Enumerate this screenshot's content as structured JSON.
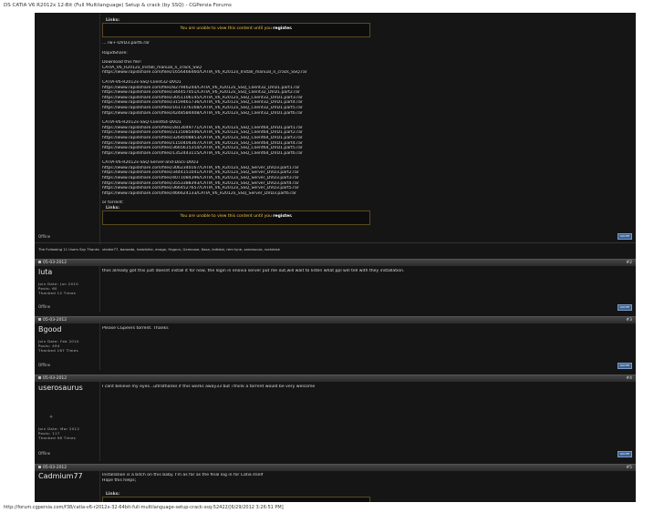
{
  "doc_title": "DS CATIA V6 R2012x 12-Bit (Full Multilanguage) Setup & crack (by SSQ) - CGPersia Forums",
  "footer_url": "http://forum.cgpersia.com/f38/catia-v6-r2012x-32-64bit-full-multilanguage-setup-crack-ssq-52422/[6/29/2012 3:26:51 PM]",
  "links_label": "Links:",
  "links_message_pre": "You are unable to view this content until you",
  "links_message_link": "register.",
  "post1": {
    "text_top": "... rw+-DVD3.part6.rar",
    "rapidshare": "RapidShare:",
    "download_intro": "Download this file!",
    "intro_lines": [
      "CATIA_V6_R2012x_Install_manual_n_crack_SSQ",
      "https://www.rapidshare.com/files/1656466460/CATIA_V6_R2012x_Install_manual_n_crack_SSQ.rar"
    ],
    "group1_title": "CATIA-V6-R2012x-SSQ-Client32-DVD1",
    "group1": [
      "https://www.rapidshare.com/files/827946244/CATIA_V6_R2012x_SSQ_Client32_DVD1.part1.rar",
      "https://www.rapidshare.com/files/344457051/CATIA_V6_R2012x_SSQ_Client32_DVD1.part2.rar",
      "https://www.rapidshare.com/files/3051106145/CATIA_V6_R2012x_SSQ_Client32_DVD1.part3.rar",
      "https://www.rapidshare.com/files/3159461736/CATIA_V6_R2012x_SSQ_Client32_DVD1.part4.rar",
      "https://www.rapidshare.com/files/1617376168/CATIA_V6_R2012x_SSQ_Client32_DVD1.part5.rar",
      "https://www.rapidshare.com/files/4248584408/CATIA_V6_R2012x_SSQ_Client32_DVD1.part6.rar"
    ],
    "group2_title": "CATIA-V6-R2012x-SSQ-Client64-DVD1",
    "group2": [
      "https://www.rapidshare.com/files/2813049771/CATIA_V6_R2012x_SSQ_Client64_DVD1.part1.rar",
      "https://www.rapidshare.com/files/2115085446/CATIA_V6_R2012x_SSQ_Client64_DVD1.part2.rar",
      "https://www.rapidshare.com/files/3264008853/CATIA_V6_R2012x_SSQ_Client64_DVD1.part3.rar",
      "https://www.rapidshare.com/files/1150404367/CATIA_V6_R2012x_SSQ_Client64_DVD1.part4.rar",
      "https://www.rapidshare.com/files/3665615354/CATIA_V6_R2012x_SSQ_Client64_DVD1.part5.rar",
      "https://www.rapidshare.com/files/1352443115/CATIA_V6_R2012x_SSQ_Client64_DVD1.part6.rar"
    ],
    "group3_title": "CATIA-V6-R2012x-SSQ-Server-and-Docs-DVD3",
    "group3": [
      "https://www.rapidshare.com/files/3062340167/CATIA_V6_R2012x_SSQ_Server_DVD3.part1.rar",
      "https://www.rapidshare.com/files/3444151041/CATIA_V6_R2012x_SSQ_Server_DVD3.part2.rar",
      "https://www.rapidshare.com/files/4071084396/CATIA_V6_R2012x_SSQ_Server_DVD3.part3.rar",
      "https://www.rapidshare.com/files/3553388393/CATIA_V6_R2012x_SSQ_Server_DVD3.part4.rar",
      "https://www.rapidshare.com/files/3664527657/CATIA_V6_R2012x_SSQ_Server_DVD3.part5.rar",
      "https://www.rapidshare.com/files/466624133/CATIA_V6_R2012x_SSQ_Server_DVD3.part6.rar"
    ],
    "or_torrent": "or torrent:",
    "offline": "Offline",
    "quote_label": "QUOTE"
  },
  "thanks": {
    "label": "The Following 11 Users Say Thank You to ... For This Useful Post:",
    "label_short": "The Following 11 Users Say Thanks",
    "users": "shebie77, baroada, hadzilzhe, enoge, frigpun, Gxmouse, Kasa, ledistal, rem·lyne, saronscuiz, rockdesk"
  },
  "posts": [
    {
      "date": "05-03-2012",
      "num": "#2",
      "user": "luta",
      "meta": [
        "Join Date: Jun 2010",
        "Posts: 60",
        "Thanked 12 Times"
      ],
      "lines": [
        "thxs already got this just doesnt install it for now, the login in enovia server put me out,will wait to listen what ppl will tell with they installation."
      ],
      "offline": "Offline",
      "quote_label": "QUOTE"
    },
    {
      "date": "05-03-2012",
      "num": "#3",
      "user": "Bgood",
      "meta": [
        "Join Date: Feb 2010",
        "Posts: 494",
        "Thanked 167 Times"
      ],
      "lines": [
        "Please CGpeers torrent. Thanks"
      ],
      "offline": "Offline",
      "quote_label": "QUOTE"
    },
    {
      "date": "05-03-2012",
      "num": "#4",
      "user": "userosaurus",
      "meta": [
        "Join Date: Mar 2012",
        "Posts: 117",
        "Thanked 98 Times"
      ],
      "lines": [
        "I cant believe my eyes...ultrathanks if this works away33 but i think a torrent would be very welcome"
      ],
      "offline": "Offline",
      "quote_label": "QUOTE"
    },
    {
      "date": "05-03-2012",
      "num": "#5",
      "user": "Cadmium77",
      "meta": [],
      "lines": [
        "Installation is a bitch on this baby. I'm as far as the final log in for Catia itself",
        "Hope this helps;"
      ],
      "offline": "",
      "quote_label": ""
    }
  ]
}
